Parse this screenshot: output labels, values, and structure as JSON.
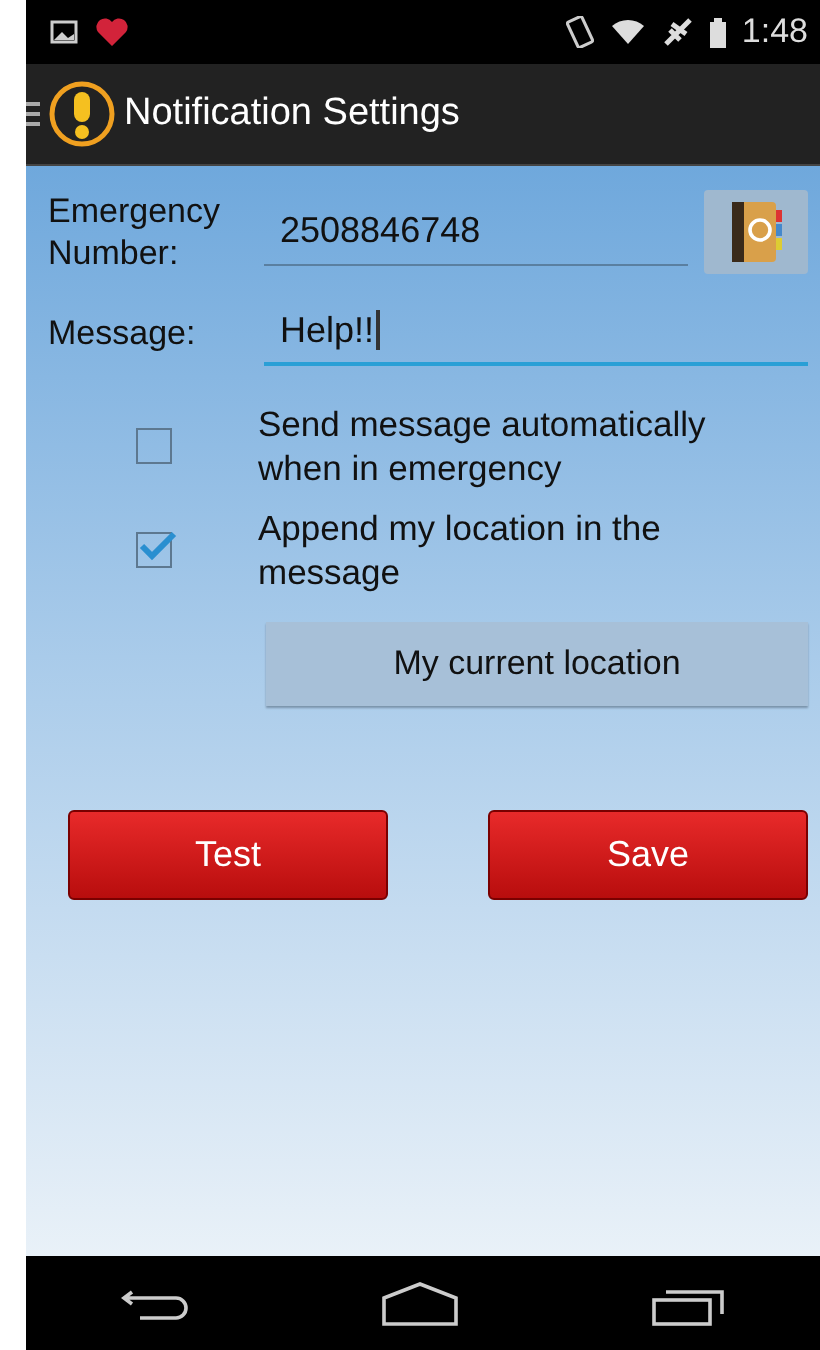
{
  "status_bar": {
    "time": "1:48"
  },
  "app_bar": {
    "title": "Notification Settings"
  },
  "form": {
    "number_label": "Emergency Number:",
    "number_value": "2508846748",
    "message_label": "Message:",
    "message_value": "Help!!",
    "message_focused": true
  },
  "options": [
    {
      "label": "Send message automatically when in emergency",
      "checked": false
    },
    {
      "label": "Append my location in the message",
      "checked": true
    }
  ],
  "location_button": "My current location",
  "buttons": [
    "Test",
    "Save"
  ]
}
